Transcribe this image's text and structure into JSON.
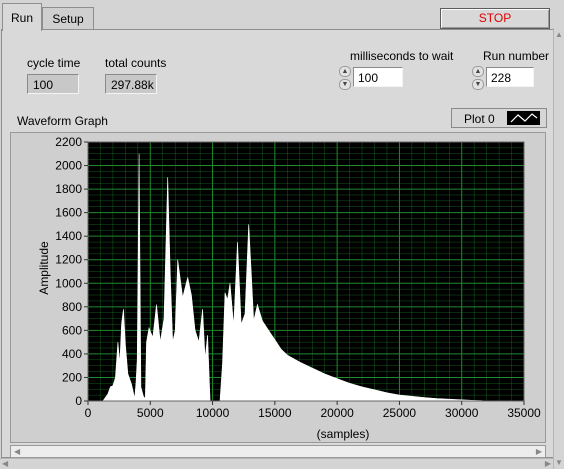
{
  "tabs": [
    {
      "label": "Run",
      "active": true
    },
    {
      "label": "Setup",
      "active": false
    }
  ],
  "stop_button": {
    "label": "STOP",
    "color": "#e00000"
  },
  "indicators": {
    "cycle_time": {
      "label": "cycle time",
      "value": "100"
    },
    "total_counts": {
      "label": "total counts",
      "value": "297.88k"
    }
  },
  "controls": {
    "ms_to_wait": {
      "label": "milliseconds to wait",
      "value": "100"
    },
    "run_number": {
      "label": "Run number",
      "value": "228"
    }
  },
  "graph": {
    "title": "Waveform Graph",
    "plot_legend": {
      "name": "Plot 0",
      "icon": "line-plot-icon"
    }
  },
  "chart_data": {
    "type": "area",
    "title": "Waveform Graph",
    "xlabel": "(samples)",
    "ylabel": "Amplitude",
    "xlim": [
      0,
      35000
    ],
    "ylim": [
      0,
      2200
    ],
    "x_ticks": [
      "0",
      "5000",
      "10000",
      "15000",
      "20000",
      "25000",
      "30000",
      "35000"
    ],
    "y_ticks": [
      "0",
      "200",
      "400",
      "600",
      "800",
      "1000",
      "1200",
      "1400",
      "1600",
      "1800",
      "2000",
      "2200"
    ],
    "grid": true,
    "plot_background": "#000000",
    "grid_color": "#1f8a2f",
    "series": [
      {
        "name": "Plot 0",
        "color": "#ffffff",
        "x": [
          1200,
          1600,
          1800,
          2000,
          2200,
          2400,
          2550,
          2700,
          2850,
          3000,
          3200,
          3500,
          3750,
          3850,
          3950,
          4100,
          4250,
          4450,
          4600,
          4700,
          4900,
          5200,
          5500,
          5800,
          6100,
          6400,
          6600,
          6800,
          7000,
          7200,
          7600,
          8000,
          8300,
          8600,
          8900,
          9200,
          9400,
          9600,
          9800,
          10000,
          10200,
          10400,
          10600,
          10800,
          11000,
          11200,
          11400,
          11700,
          12000,
          12300,
          12600,
          12900,
          13100,
          13300,
          13600,
          14000,
          14500,
          15000,
          15500,
          16000,
          17000,
          18000,
          19000,
          20000,
          21000,
          22000,
          23000,
          24000,
          25000,
          26000,
          27000,
          28000,
          29000,
          30000,
          31000,
          31500,
          32000
        ],
        "y": [
          0,
          60,
          120,
          130,
          200,
          500,
          320,
          660,
          780,
          480,
          230,
          140,
          20,
          160,
          350,
          2100,
          120,
          40,
          20,
          500,
          620,
          540,
          820,
          500,
          700,
          1900,
          1100,
          500,
          600,
          1200,
          880,
          1050,
          900,
          600,
          500,
          780,
          360,
          560,
          0,
          0,
          0,
          0,
          0,
          320,
          920,
          860,
          1000,
          640,
          1350,
          650,
          740,
          1500,
          1100,
          680,
          820,
          680,
          600,
          520,
          440,
          390,
          330,
          280,
          230,
          190,
          150,
          120,
          95,
          70,
          50,
          40,
          30,
          20,
          15,
          10,
          5,
          3,
          0
        ]
      }
    ]
  }
}
